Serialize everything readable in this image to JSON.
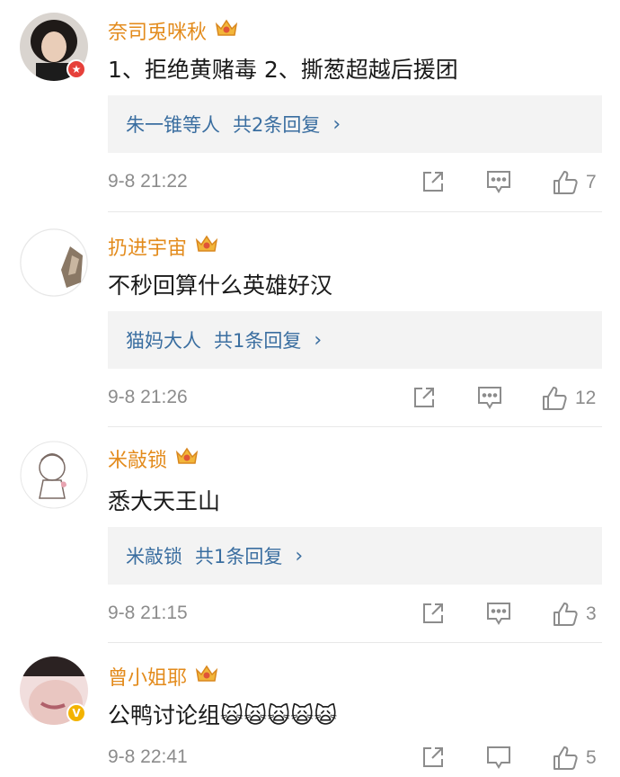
{
  "comments": [
    {
      "username": "奈司兎咪秋",
      "text": "1、拒绝黄赌毒 2、撕葱超越后援团",
      "reply": {
        "names": "朱一锥等人",
        "count_text": "共2条回复"
      },
      "time": "9-8 21:22",
      "likes": "7",
      "avatar_badge": "red-star-badge"
    },
    {
      "username": "扔进宇宙",
      "text": "不秒回算什么英雄好汉",
      "reply": {
        "names": "猫妈大人",
        "count_text": "共1条回复"
      },
      "time": "9-8 21:26",
      "likes": "12"
    },
    {
      "username": "米敲锁",
      "text": "悉大天王山",
      "reply": {
        "names": "米敲锁",
        "count_text": "共1条回复"
      },
      "time": "9-8 21:15",
      "likes": "3"
    },
    {
      "username": "曾小姐耶",
      "text": "公鸭讨论组",
      "emoji": "🙀🙀🙀🙀🙀",
      "time": "9-8 22:41",
      "likes": "5",
      "avatar_badge": "yellow-v-badge"
    }
  ],
  "colors": {
    "username": "#e38b1c",
    "reply_link": "#3a6ea0",
    "meta": "#8c8c8c",
    "reply_bg": "#f3f3f3"
  },
  "icons": [
    "crown-icon",
    "share-icon",
    "comment-icon",
    "thumbs-up-icon",
    "chevron-right-icon"
  ]
}
